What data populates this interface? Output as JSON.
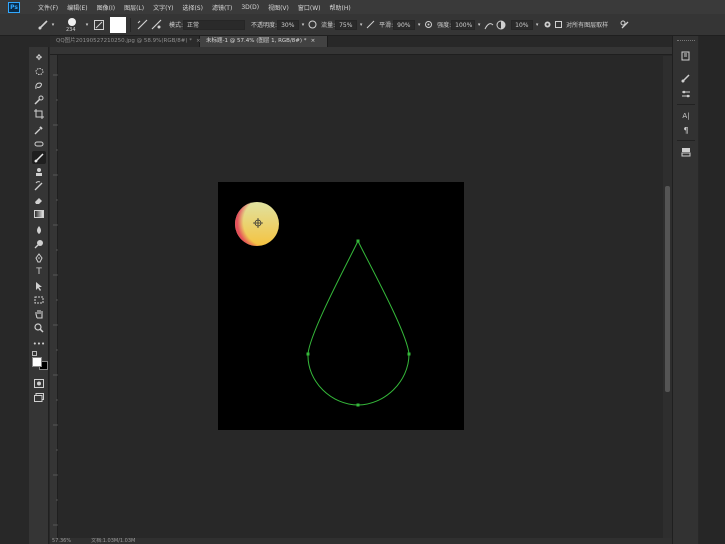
{
  "menubar": {
    "logo": "Ps",
    "items": [
      "文件(F)",
      "编辑(E)",
      "图像(I)",
      "图层(L)",
      "文字(Y)",
      "选择(S)",
      "滤镜(T)",
      "3D(D)",
      "视图(V)",
      "窗口(W)",
      "帮助(H)"
    ]
  },
  "options": {
    "brush_size": "234",
    "mode_label": "模式:",
    "mode_value": "正常",
    "opacity_label": "不透明度:",
    "opacity_value": "30%",
    "flow_label": "流量:",
    "flow_value": "75%",
    "smoothing_label": "平滑:",
    "smoothing_value": "90%",
    "strength_label": "强度:",
    "strength_value": "100%",
    "angle_value": "10%",
    "sample_all_label": "对所有图层取样"
  },
  "tabs": [
    {
      "label": "QQ图片20190527210250.jpg @ 58.9%(RGB/8#) *",
      "close": "×"
    },
    {
      "label": "未标题-1 @ 57.4% (图层 1, RGB/8#) *",
      "close": "×"
    }
  ],
  "tools": [
    "move-tool",
    "marquee-tool",
    "lasso-tool",
    "quick-select-tool",
    "crop-tool",
    "eyedropper-tool",
    "healing-tool",
    "brush-tool",
    "stamp-tool",
    "history-brush-tool",
    "eraser-tool",
    "gradient-tool",
    "blur-tool",
    "dodge-tool",
    "pen-tool",
    "type-tool",
    "path-select-tool",
    "shape-tool",
    "hand-tool",
    "zoom-tool"
  ],
  "statusbar": {
    "zoom": "57.36%",
    "doc": "文档:1.03M/1.03M"
  },
  "colors": {
    "path_stroke": "#35b83a",
    "gradient_top": "#e0e2a0",
    "gradient_bottom": "#f5c340",
    "gradient_edge": "#e3425a"
  }
}
